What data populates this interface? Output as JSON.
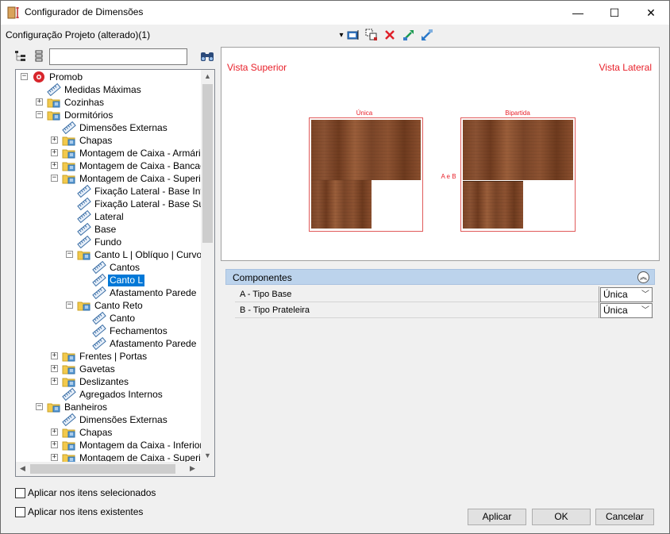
{
  "window": {
    "title": "Configurador de Dimensões",
    "minimize_glyph": "—",
    "maximize_glyph": "☐",
    "close_glyph": "✕"
  },
  "config_label": "Configuração Projeto (alterado)(1)",
  "toolbar": {
    "dropdown_glyph": "▾",
    "icons": [
      "select-icon",
      "copy-icon",
      "delete-icon",
      "export-icon",
      "import-icon"
    ]
  },
  "search": {
    "value": "",
    "placeholder": ""
  },
  "tree": {
    "items": [
      {
        "label": "Promob",
        "level": 0,
        "expander": "minus",
        "icon": "promob-logo-icon"
      },
      {
        "label": "Medidas Máximas",
        "level": 1,
        "expander": "none",
        "icon": "ruler-icon"
      },
      {
        "label": "Cozinhas",
        "level": 1,
        "expander": "plus",
        "icon": "folder-icon"
      },
      {
        "label": "Dormitórios",
        "level": 1,
        "expander": "minus",
        "icon": "folder-icon"
      },
      {
        "label": "Dimensões Externas",
        "level": 2,
        "expander": "none",
        "icon": "ruler-icon"
      },
      {
        "label": "Chapas",
        "level": 2,
        "expander": "plus",
        "icon": "folder-icon"
      },
      {
        "label": "Montagem de Caixa - Armários",
        "level": 2,
        "expander": "plus",
        "icon": "folder-icon"
      },
      {
        "label": "Montagem de Caixa - Bancadas",
        "level": 2,
        "expander": "plus",
        "icon": "folder-icon"
      },
      {
        "label": "Montagem de Caixa - Superior",
        "level": 2,
        "expander": "minus",
        "icon": "folder-icon"
      },
      {
        "label": "Fixação Lateral - Base Inferior",
        "level": 3,
        "expander": "none",
        "icon": "ruler-icon"
      },
      {
        "label": "Fixação Lateral - Base Superior",
        "level": 3,
        "expander": "none",
        "icon": "ruler-icon"
      },
      {
        "label": "Lateral",
        "level": 3,
        "expander": "none",
        "icon": "ruler-icon"
      },
      {
        "label": "Base",
        "level": 3,
        "expander": "none",
        "icon": "ruler-icon"
      },
      {
        "label": "Fundo",
        "level": 3,
        "expander": "none",
        "icon": "ruler-icon"
      },
      {
        "label": "Canto L | Oblíquo | Curvo",
        "level": 3,
        "expander": "minus",
        "icon": "folder-icon"
      },
      {
        "label": "Cantos",
        "level": 4,
        "expander": "none",
        "icon": "ruler-icon"
      },
      {
        "label": "Canto L",
        "level": 4,
        "expander": "none",
        "icon": "ruler-icon",
        "selected": true
      },
      {
        "label": "Afastamento Parede",
        "level": 4,
        "expander": "none",
        "icon": "ruler-icon"
      },
      {
        "label": "Canto Reto",
        "level": 3,
        "expander": "minus",
        "icon": "folder-icon"
      },
      {
        "label": "Canto",
        "level": 4,
        "expander": "none",
        "icon": "ruler-icon"
      },
      {
        "label": "Fechamentos",
        "level": 4,
        "expander": "none",
        "icon": "ruler-icon"
      },
      {
        "label": "Afastamento Parede",
        "level": 4,
        "expander": "none",
        "icon": "ruler-icon"
      },
      {
        "label": "Frentes | Portas",
        "level": 2,
        "expander": "plus",
        "icon": "folder-icon"
      },
      {
        "label": "Gavetas",
        "level": 2,
        "expander": "plus",
        "icon": "folder-icon"
      },
      {
        "label": "Deslizantes",
        "level": 2,
        "expander": "plus",
        "icon": "folder-icon"
      },
      {
        "label": "Agregados Internos",
        "level": 2,
        "expander": "none",
        "icon": "ruler-icon"
      },
      {
        "label": "Banheiros",
        "level": 1,
        "expander": "minus",
        "icon": "folder-icon"
      },
      {
        "label": "Dimensões Externas",
        "level": 2,
        "expander": "none",
        "icon": "ruler-icon"
      },
      {
        "label": "Chapas",
        "level": 2,
        "expander": "plus",
        "icon": "folder-icon"
      },
      {
        "label": "Montagem da Caixa - Inferior",
        "level": 2,
        "expander": "plus",
        "icon": "folder-icon"
      },
      {
        "label": "Montagem de Caixa - Superior",
        "level": 2,
        "expander": "plus",
        "icon": "folder-icon"
      }
    ]
  },
  "preview": {
    "vista_superior": "Vista Superior",
    "vista_lateral": "Vista Lateral",
    "left_caption": "Única",
    "right_caption": "Bipartida",
    "middle_label": "A e B",
    "accent_color": "#e8202a"
  },
  "components": {
    "title": "Componentes",
    "collapse_glyph": "︽",
    "rows": [
      {
        "name": "A - Tipo Base",
        "value": "Única"
      },
      {
        "name": "B - Tipo Prateleira",
        "value": "Única"
      }
    ]
  },
  "checkboxes": {
    "apply_selected": "Aplicar nos itens selecionados",
    "apply_existing": "Aplicar nos itens existentes"
  },
  "buttons": {
    "apply": "Aplicar",
    "ok": "OK",
    "cancel": "Cancelar"
  }
}
